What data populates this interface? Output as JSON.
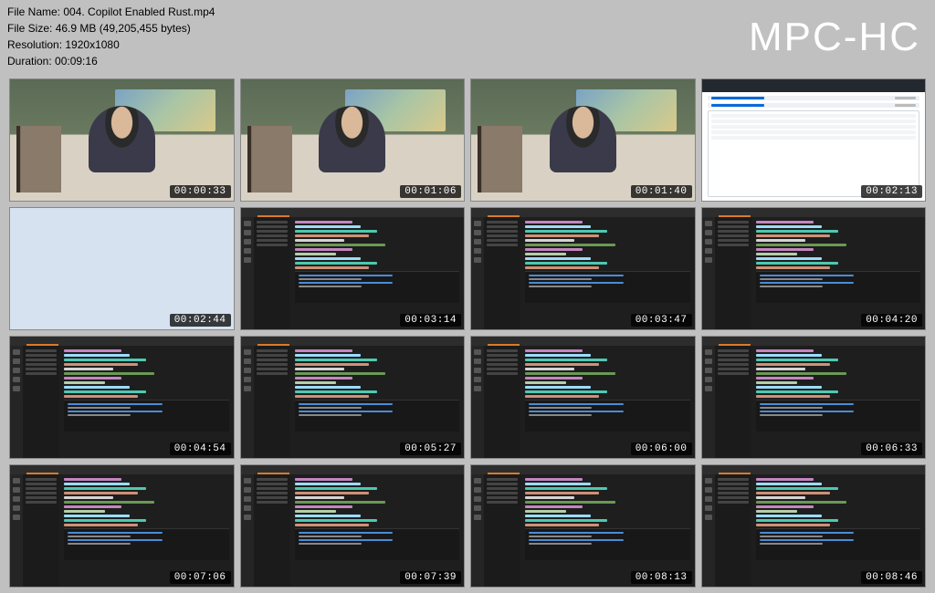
{
  "app": {
    "watermark": "MPC-HC"
  },
  "meta": {
    "file_name_label": "File Name: ",
    "file_name": "004. Copilot Enabled Rust.mp4",
    "file_size_label": "File Size: ",
    "file_size": "46.9 MB (49,205,455 bytes)",
    "resolution_label": "Resolution: ",
    "resolution": "1920x1080",
    "duration_label": "Duration: ",
    "duration": "00:09:16"
  },
  "thumbnails": [
    {
      "kind": "webcam",
      "timestamp": "00:00:33"
    },
    {
      "kind": "webcam",
      "timestamp": "00:01:06"
    },
    {
      "kind": "webcam",
      "timestamp": "00:01:40"
    },
    {
      "kind": "browser",
      "timestamp": "00:02:13"
    },
    {
      "kind": "light",
      "timestamp": "00:02:44"
    },
    {
      "kind": "ide",
      "timestamp": "00:03:14"
    },
    {
      "kind": "ide",
      "timestamp": "00:03:47"
    },
    {
      "kind": "ide",
      "timestamp": "00:04:20"
    },
    {
      "kind": "ide",
      "timestamp": "00:04:54"
    },
    {
      "kind": "ide",
      "timestamp": "00:05:27"
    },
    {
      "kind": "ide",
      "timestamp": "00:06:00"
    },
    {
      "kind": "ide",
      "timestamp": "00:06:33"
    },
    {
      "kind": "ide",
      "timestamp": "00:07:06"
    },
    {
      "kind": "ide",
      "timestamp": "00:07:39"
    },
    {
      "kind": "ide",
      "timestamp": "00:08:13"
    },
    {
      "kind": "ide",
      "timestamp": "00:08:46"
    }
  ]
}
